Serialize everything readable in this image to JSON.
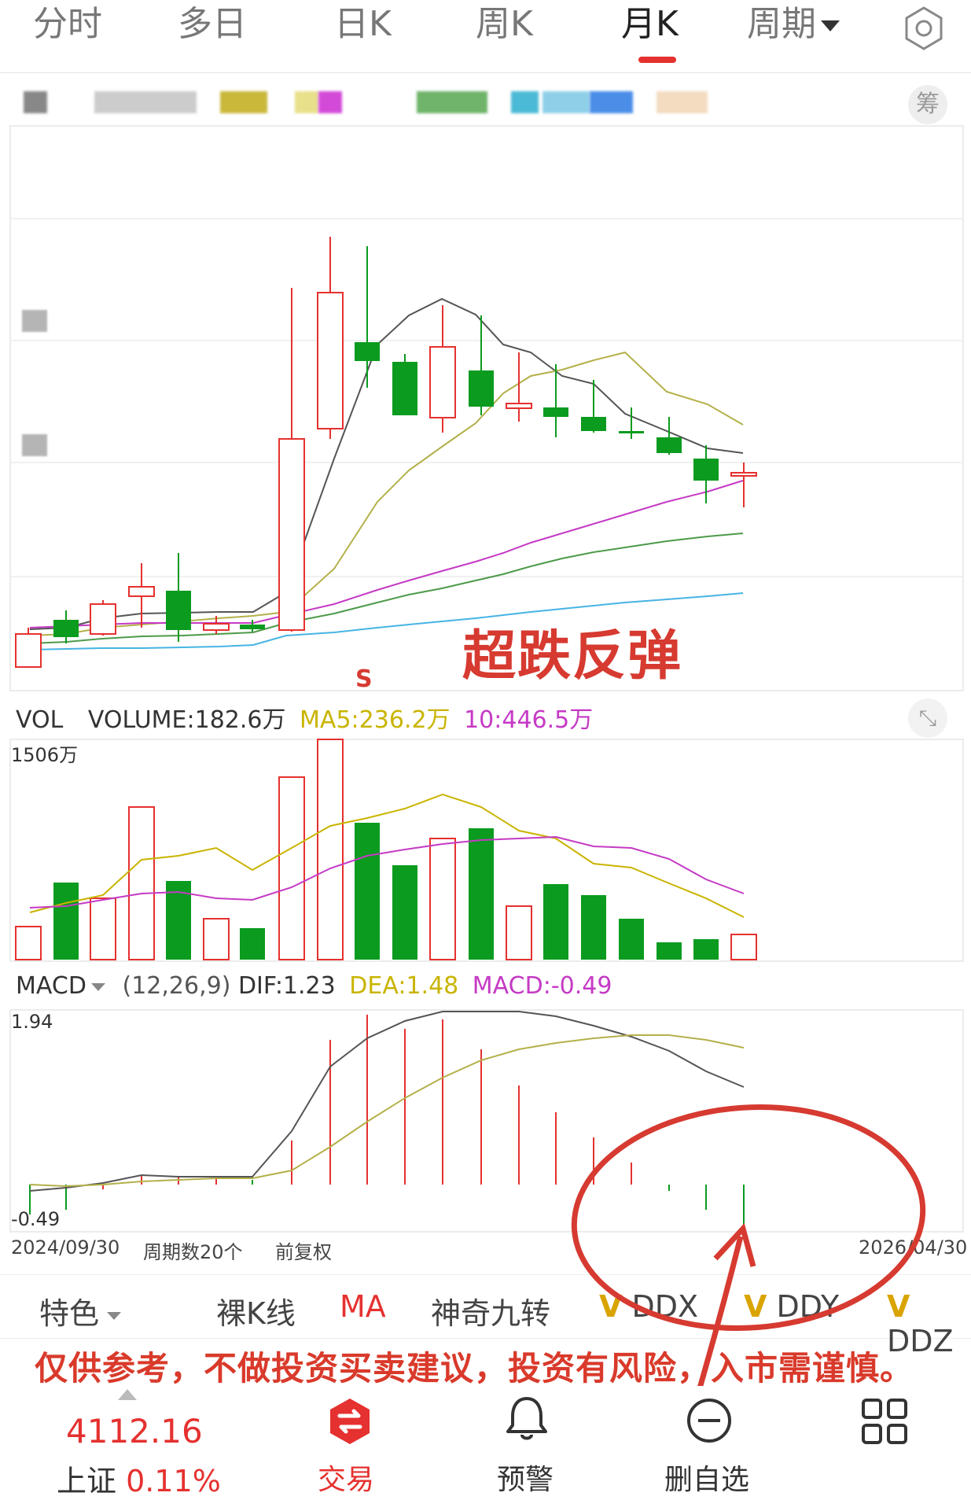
{
  "tabs": [
    "分时",
    "多日",
    "日K",
    "周K",
    "月K",
    "周期"
  ],
  "active_tab": "月K",
  "ma_row": {
    "chip_button": "筹"
  },
  "main_chart": {
    "annotation": "超跌反弹",
    "signal_mark": "S"
  },
  "volume": {
    "head_label": "VOL",
    "volume_text": "VOLUME:182.6万",
    "ma5_text": "MA5:236.2万",
    "ma10_text": "10:446.5万",
    "max_label": "1506万",
    "ma5_color": "#c9b400",
    "ma10_color": "#c53ac5"
  },
  "macd": {
    "head_label": "MACD",
    "params": "(12,26,9)",
    "dif_text": "DIF:1.23",
    "dea_text": "DEA:1.48",
    "macd_text": "MACD:-0.49",
    "max_label": "1.94",
    "min_label": "-0.49"
  },
  "axis": {
    "start_date": "2024/09/30",
    "period_count": "周期数20个",
    "adjust": "前复权",
    "end_date": "2026/04/30"
  },
  "toolbar": {
    "feature": "特色",
    "items": [
      "裸K线",
      "MA",
      "神奇九转",
      "DDX",
      "DDY",
      "DDZ"
    ]
  },
  "disclaimer": "仅供参考，不做投资买卖建议，投资有风险，入市需谨慎。",
  "bottom_nav": {
    "index_value": "4112.16",
    "index_name": "上证",
    "index_pct": "0.11%",
    "trade": "交易",
    "alert": "预警",
    "remove_watch": "删自选"
  },
  "colors": {
    "up": "#e5312f",
    "down": "#0a9b1f",
    "accent": "#e5312f"
  }
}
